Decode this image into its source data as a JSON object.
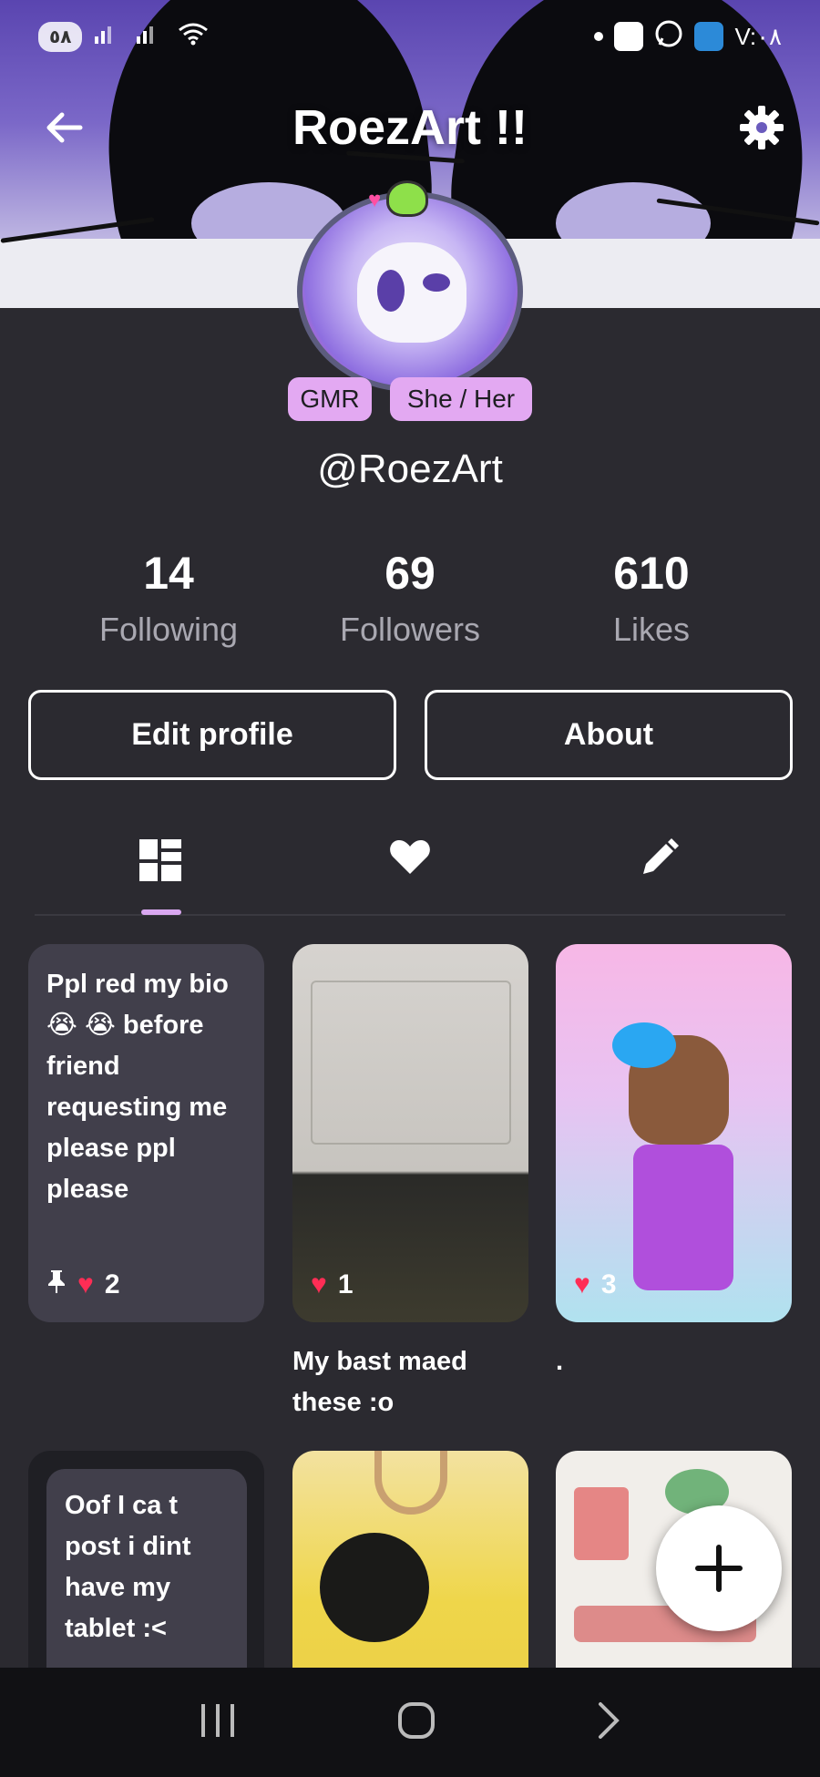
{
  "status_bar": {
    "time": "V:٠٨",
    "data_pill": "٥٨"
  },
  "header": {
    "title": "RoezArt !!"
  },
  "profile": {
    "badges": [
      "GMR",
      "She / Her"
    ],
    "handle": "@RoezArt"
  },
  "stats": [
    {
      "value": "14",
      "label": "Following"
    },
    {
      "value": "69",
      "label": "Followers"
    },
    {
      "value": "610",
      "label": "Likes"
    }
  ],
  "actions": {
    "edit_label": "Edit profile",
    "about_label": "About"
  },
  "tabs": [
    {
      "icon": "grid-icon",
      "active": true
    },
    {
      "icon": "heart-icon",
      "active": false
    },
    {
      "icon": "pencil-icon",
      "active": false
    }
  ],
  "posts": [
    {
      "text": "Ppl red my bio 😭 😭 before friend requesting me please ppl please",
      "likes": "2",
      "pinned": true
    },
    {
      "likes": "1",
      "caption": "My bast maed these :o"
    },
    {
      "likes": "3",
      "caption": "."
    },
    {
      "text": "Oof I ca t post i dint have my tablet :<"
    },
    {},
    {}
  ],
  "colors": {
    "background": "#2b2a30",
    "accent": "#d9a7f0",
    "like": "#ff2d55"
  }
}
